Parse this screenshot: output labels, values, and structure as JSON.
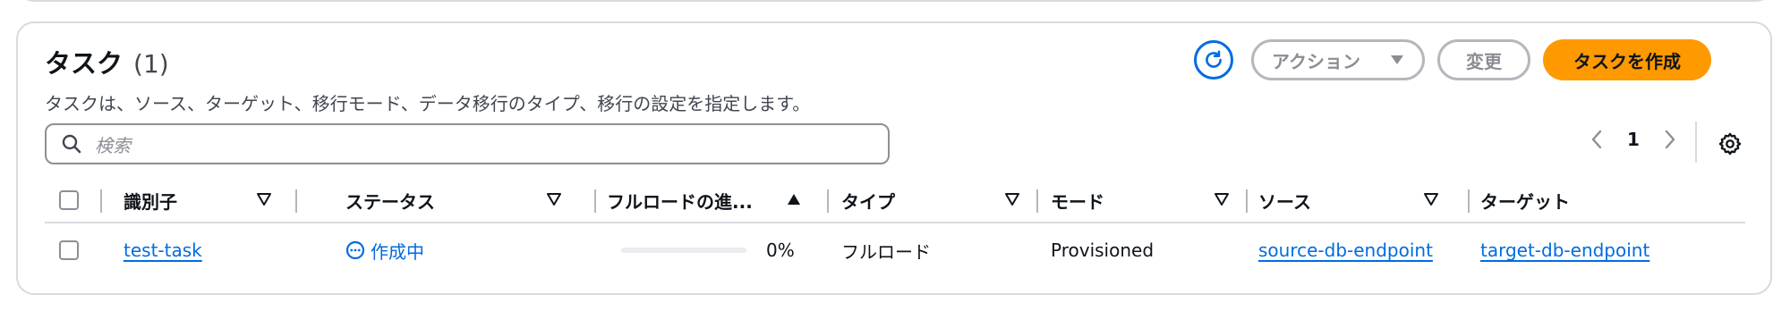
{
  "header": {
    "title": "タスク",
    "count": "(1)",
    "description": "タスクは、ソース、ターゲット、移行モード、データ移行のタイプ、移行の設定を指定します。"
  },
  "toolbar": {
    "refresh_icon": "refresh-icon",
    "actions_label": "アクション",
    "edit_label": "変更",
    "create_label": "タスクを作成"
  },
  "search": {
    "placeholder": "検索",
    "value": ""
  },
  "pagination": {
    "current_page": "1"
  },
  "table": {
    "columns": [
      "識別子",
      "ステータス",
      "フルロードの進...",
      "タイプ",
      "モード",
      "ソース",
      "ターゲット"
    ],
    "rows": [
      {
        "identifier": "test-task",
        "status": "作成中",
        "progress_percent": 0,
        "progress_label": "0%",
        "type": "フルロード",
        "mode": "Provisioned",
        "source": "source-db-endpoint",
        "target": "target-db-endpoint"
      }
    ]
  },
  "colors": {
    "accent": "#006ce0",
    "primary_button": "#ff9900",
    "disabled": "#8c8c94",
    "border": "#d8dade"
  }
}
